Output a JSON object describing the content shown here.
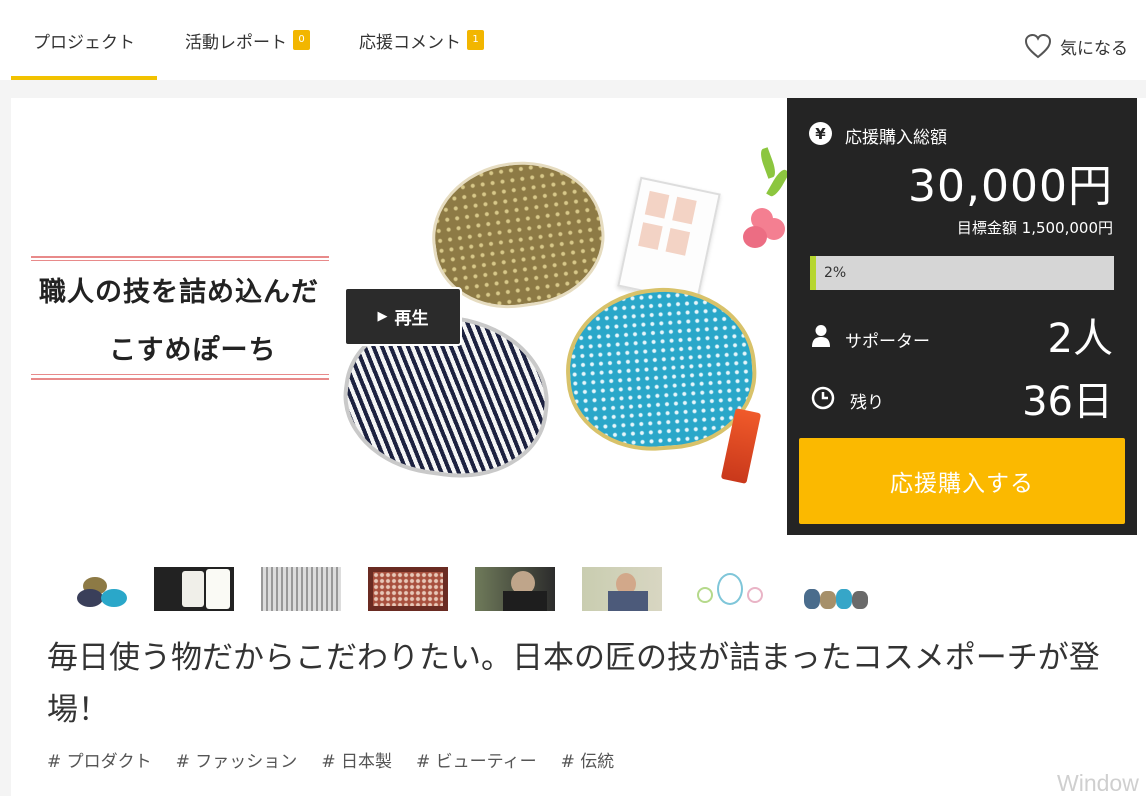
{
  "nav": {
    "tabs": [
      {
        "label": "プロジェクト",
        "badge": null
      },
      {
        "label": "活動レポート",
        "badge": "0"
      },
      {
        "label": "応援コメント",
        "badge": "1"
      }
    ],
    "favorite_label": "気になる"
  },
  "hero": {
    "headline_line1": "職人の技を詰め込んだ",
    "headline_line2": "こすめぽーち",
    "play_label": "再生"
  },
  "panel": {
    "total_label": "応援購入総額",
    "total_value": "30,000円",
    "goal_text": "目標金額 1,500,000円",
    "progress_percent": 2,
    "progress_label": "2%",
    "supporters_label": "サポーター",
    "supporters_value": "2人",
    "remaining_label": "残り",
    "remaining_value": "36日",
    "buy_label": "応援購入する",
    "colors": {
      "panel_bg": "#242424",
      "buy_button": "#fbb900",
      "progress_fill": "#b6d62f",
      "accent_underline": "#f2c200"
    }
  },
  "thumbnails": [
    {
      "name": "pouches"
    },
    {
      "name": "thread-spools"
    },
    {
      "name": "loom"
    },
    {
      "name": "fabric"
    },
    {
      "name": "craftsman-workshop"
    },
    {
      "name": "craftsman-portrait"
    },
    {
      "name": "iwami-logo"
    },
    {
      "name": "iwami-pouches"
    }
  ],
  "title": "毎日使う物だからこだわりたい。日本の匠の技が詰まったコスメポーチが登場！",
  "tags": [
    "# プロダクト",
    "# ファッション",
    "# 日本製",
    "# ビューティー",
    "# 伝統"
  ],
  "watermark": "Window"
}
